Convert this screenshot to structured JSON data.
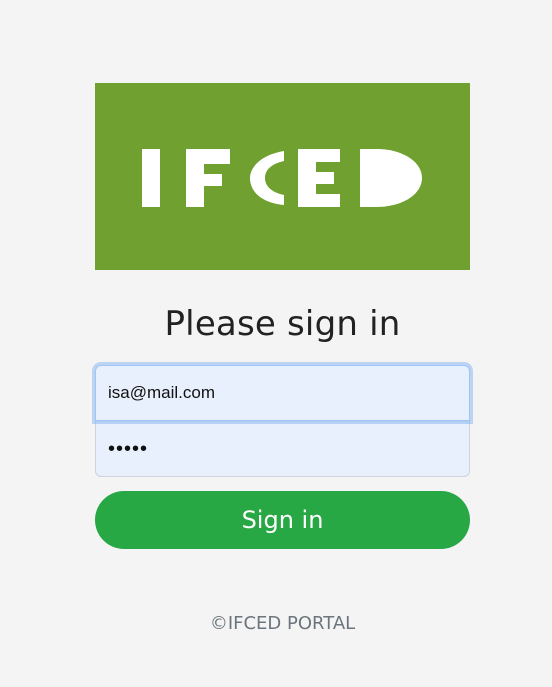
{
  "logo": {
    "text": "IFCED",
    "background": "#6fa030"
  },
  "form": {
    "heading": "Please sign in",
    "email_value": "isa@mail.com",
    "password_value": "•••••",
    "submit_label": "Sign in"
  },
  "footer": {
    "text": "©IFCED PORTAL"
  },
  "colors": {
    "primary": "#28a745",
    "input_autofill": "#e8f0fe",
    "page_background": "#f4f4f4"
  }
}
